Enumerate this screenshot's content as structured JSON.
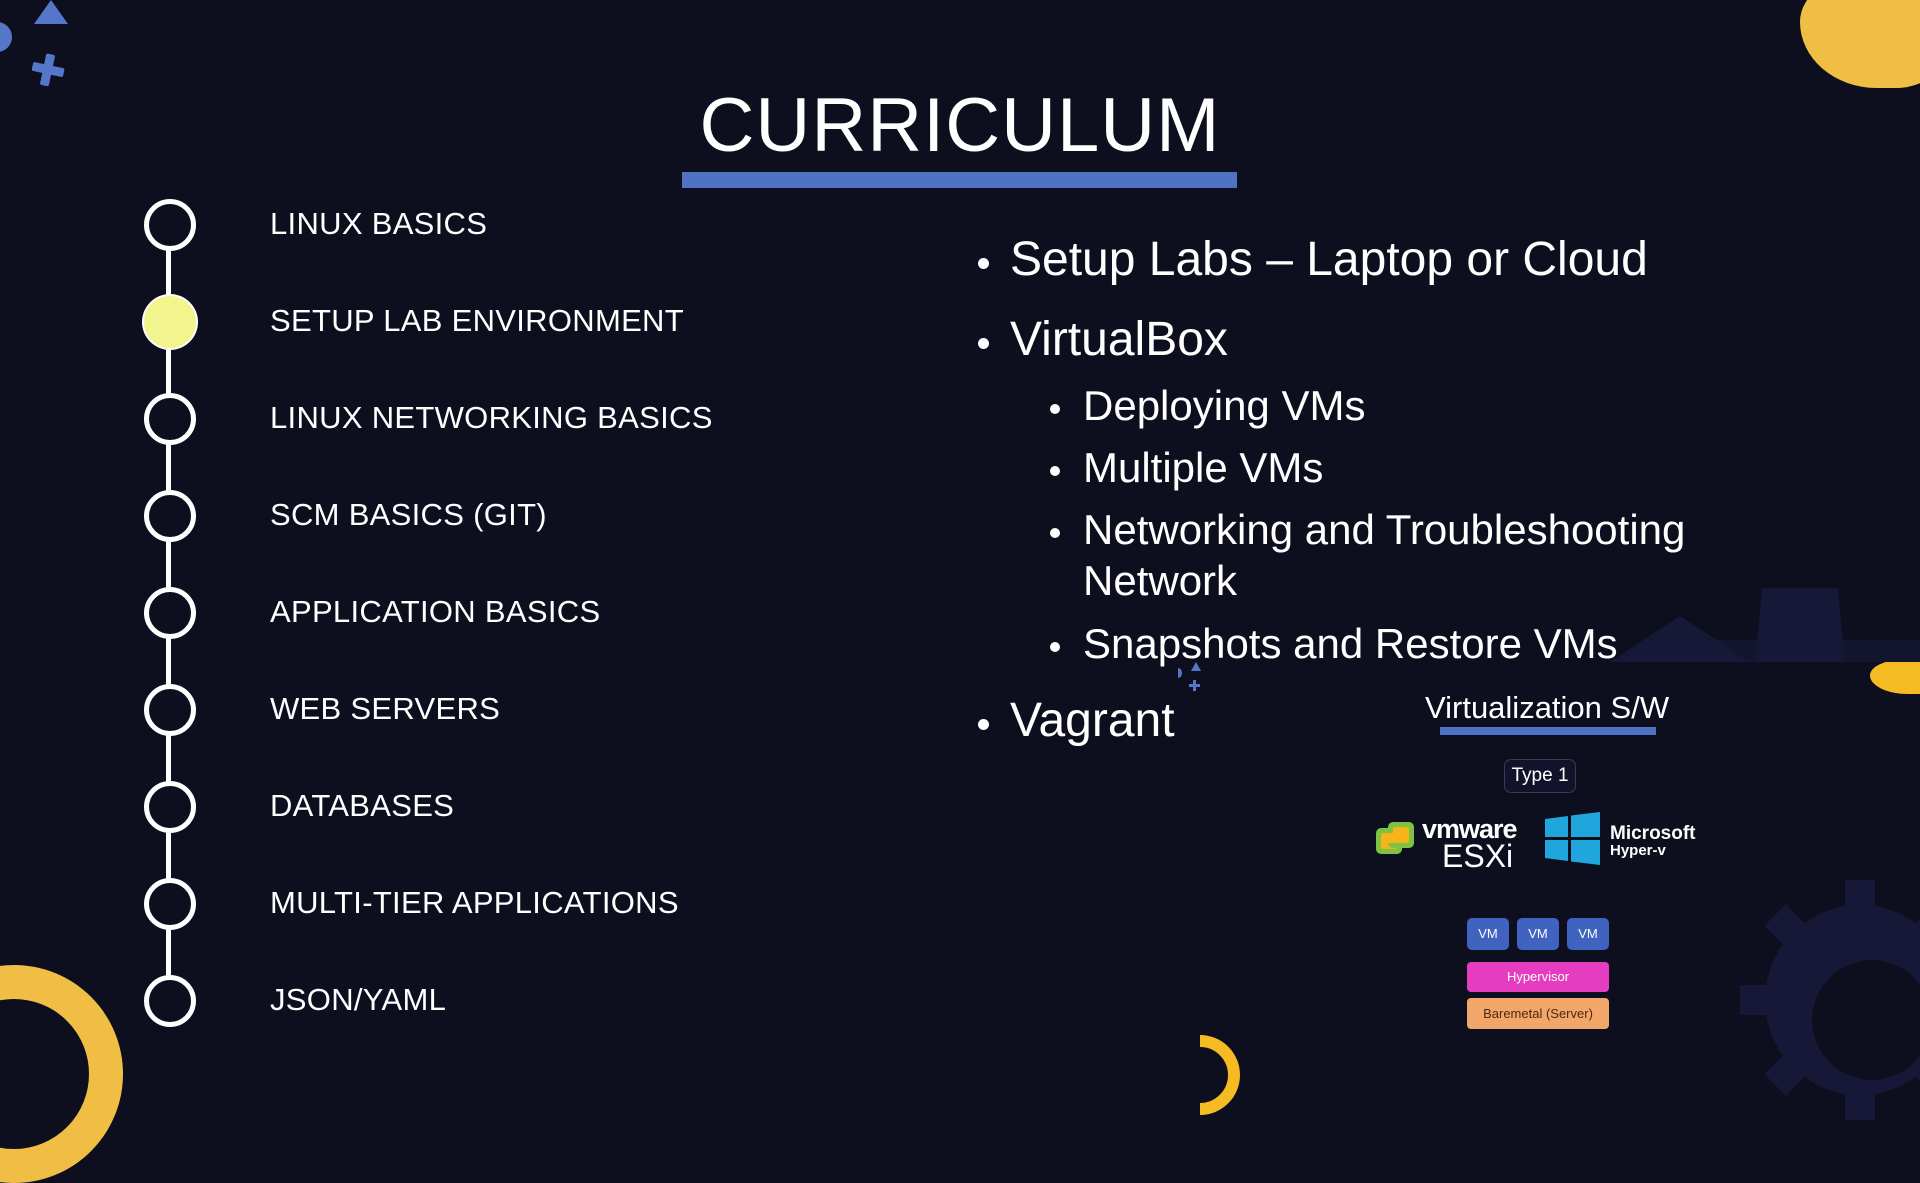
{
  "slide": {
    "title": "CURRICULUM",
    "colors": {
      "background": "#0e0f1e",
      "accent_blue": "#4f72c4",
      "accent_yellow": "#f0be45",
      "active_node": "#f2f58d",
      "hypervisor": "#e43dc0",
      "baremetal": "#f2a66a",
      "vm_box": "#4063c0"
    }
  },
  "timeline": {
    "items": [
      {
        "label": "LINUX BASICS",
        "active": false
      },
      {
        "label": "SETUP LAB ENVIRONMENT",
        "active": true
      },
      {
        "label": "LINUX NETWORKING BASICS",
        "active": false
      },
      {
        "label": "SCM BASICS (GIT)",
        "active": false
      },
      {
        "label": "APPLICATION BASICS",
        "active": false
      },
      {
        "label": "WEB SERVERS",
        "active": false
      },
      {
        "label": "DATABASES",
        "active": false
      },
      {
        "label": "MULTI-TIER APPLICATIONS",
        "active": false
      },
      {
        "label": "JSON/YAML",
        "active": false
      }
    ]
  },
  "bullets": {
    "items": [
      {
        "text": "Setup Labs – Laptop or Cloud",
        "level": 1
      },
      {
        "text": "VirtualBox",
        "level": 1
      },
      {
        "text": "Deploying VMs",
        "level": 2
      },
      {
        "text": "Multiple VMs",
        "level": 2
      },
      {
        "text": "Networking and Troubleshooting",
        "level": 2
      },
      {
        "text": "Network",
        "level": 2,
        "continuation": true
      },
      {
        "text": "Snapshots and Restore VMs",
        "level": 2
      },
      {
        "text": "Vagrant",
        "level": 1
      }
    ]
  },
  "virtualization": {
    "heading": "Virtualization S/W",
    "type_label": "Type 1",
    "products": [
      {
        "brand": "vmware",
        "name": "ESXi",
        "icon": "vmware-logo-icon"
      },
      {
        "brand": "Microsoft",
        "name": "Hyper-v",
        "icon": "windows-logo-icon"
      }
    ],
    "stack": {
      "vms": [
        "VM",
        "VM",
        "VM"
      ],
      "hypervisor": "Hypervisor",
      "baremetal": "Baremetal (Server)"
    }
  }
}
